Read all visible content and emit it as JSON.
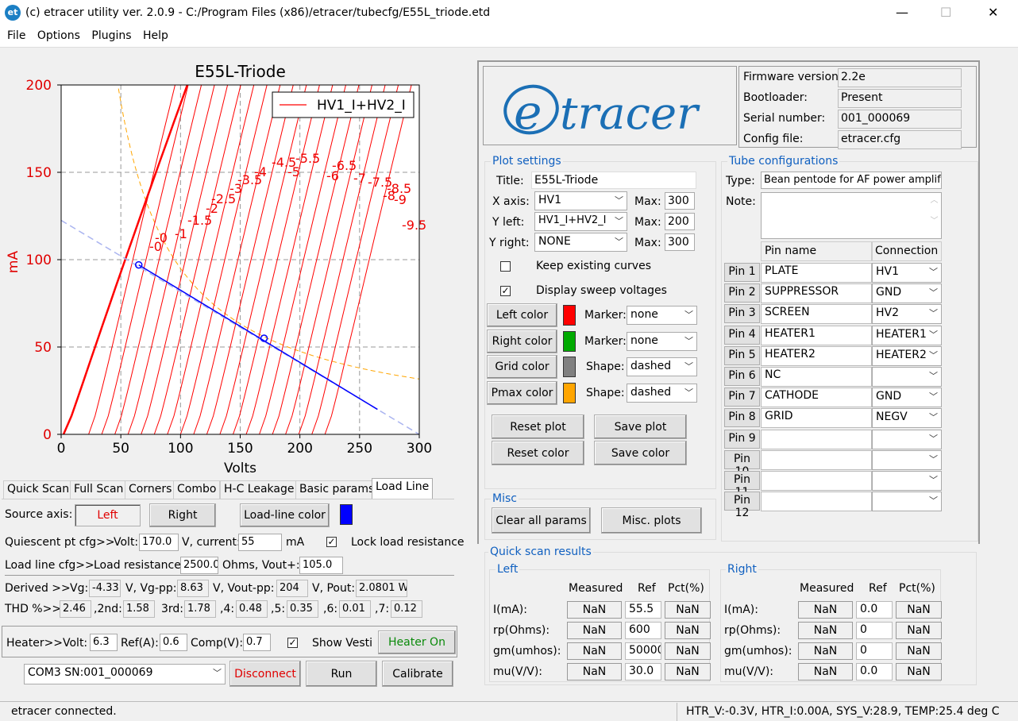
{
  "window": {
    "title": "(c) etracer utility ver. 2.0.9 - C:/Program Files (x86)/etracer/tubecfg/E55L_triode.etd",
    "icon_text": "et",
    "minimize": "—",
    "maximize": "☐",
    "close": "✕"
  },
  "menu": [
    "File",
    "Options",
    "Plugins",
    "Help"
  ],
  "chart_data": {
    "type": "line",
    "title": "E55L-Triode",
    "xlabel": "Volts",
    "ylabel": "mA",
    "xlim": [
      0,
      300
    ],
    "ylim": [
      0,
      200
    ],
    "xticks": [
      "0",
      "50",
      "100",
      "150",
      "200",
      "250",
      "300"
    ],
    "yticks": [
      "0",
      "50",
      "100",
      "150",
      "200"
    ],
    "legend": {
      "label": "HV1_I+HV2_I",
      "placement": "top-right"
    },
    "grid": true,
    "series_color": "#ff0000",
    "grid_voltages": [
      "-0",
      "-0",
      "-1",
      "-1.5",
      "-2",
      "-2.5",
      "-3",
      "-3.5",
      "-4",
      "-4.5",
      "-5",
      "-5.5",
      "-6",
      "-6.5",
      "-7",
      "-7.5",
      "-8",
      "-8.5",
      "-9",
      "-9.5"
    ],
    "load_line": {
      "x": [
        0,
        300
      ],
      "y": [
        122.5,
        0
      ]
    },
    "quiescent_points": [
      {
        "x": 65,
        "y": 97
      },
      {
        "x": 170,
        "y": 55
      }
    ]
  },
  "logo": "etracer",
  "firmware": {
    "rows": [
      {
        "label": "Firmware version:",
        "value": "2.2e"
      },
      {
        "label": "Bootloader:",
        "value": "Present"
      },
      {
        "label": "Serial number:",
        "value": "001_000069"
      },
      {
        "label": "Config file:",
        "value": "etracer.cfg"
      }
    ]
  },
  "plot_settings": {
    "group_title": "Plot settings",
    "title_label": "Title:",
    "title_value": "E55L-Triode",
    "x_axis_label": "X axis:",
    "x_axis_value": "HV1",
    "x_max_label": "Max:",
    "x_max": "300",
    "y_left_label": "Y left:",
    "y_left_value": "HV1_I+HV2_I",
    "y_left_max_label": "Max:",
    "y_left_max": "200",
    "y_right_label": "Y right:",
    "y_right_value": "NONE",
    "y_right_max_label": "Max:",
    "y_right_max": "300",
    "keep_curves": "Keep existing curves",
    "display_sweep": "Display sweep voltages",
    "left_color": "Left color",
    "right_color": "Right color",
    "grid_color": "Grid color",
    "pmax_color": "Pmax color",
    "marker_label": "Marker:",
    "shape_label": "Shape:",
    "left_marker": "none",
    "right_marker": "none",
    "grid_shape": "dashed",
    "pmax_shape": "dashed",
    "left_swatch": "#ff0000",
    "right_swatch": "#00aa00",
    "grid_swatch": "#808080",
    "pmax_swatch": "#ffa500",
    "reset_plot": "Reset plot",
    "save_plot": "Save plot",
    "reset_color": "Reset color",
    "save_color": "Save color"
  },
  "misc": {
    "group_title": "Misc",
    "clear_all": "Clear all params",
    "misc_plots": "Misc. plots"
  },
  "tube": {
    "group_title": "Tube configurations",
    "type_label": "Type:",
    "type_value": "Bean pentode for AF power amplif",
    "note_label": "Note:",
    "pin_name_header": "Pin name",
    "connection_header": "Connection",
    "pins": [
      {
        "btn": "Pin 1",
        "name": "PLATE",
        "conn": "HV1"
      },
      {
        "btn": "Pin 2",
        "name": "SUPPRESSOR",
        "conn": "GND"
      },
      {
        "btn": "Pin 3",
        "name": "SCREEN",
        "conn": "HV2"
      },
      {
        "btn": "Pin 4",
        "name": "HEATER1",
        "conn": "HEATER1"
      },
      {
        "btn": "Pin 5",
        "name": "HEATER2",
        "conn": "HEATER2"
      },
      {
        "btn": "Pin 6",
        "name": "NC",
        "conn": ""
      },
      {
        "btn": "Pin 7",
        "name": "CATHODE",
        "conn": "GND"
      },
      {
        "btn": "Pin 8",
        "name": "GRID",
        "conn": "NEGV"
      },
      {
        "btn": "Pin 9",
        "name": "",
        "conn": ""
      },
      {
        "btn": "Pin 10",
        "name": "",
        "conn": ""
      },
      {
        "btn": "Pin 11",
        "name": "",
        "conn": ""
      },
      {
        "btn": "Pin 12",
        "name": "",
        "conn": ""
      }
    ]
  },
  "quick_scan": {
    "group_title": "Quick scan results",
    "left_title": "Left",
    "right_title": "Right",
    "headers": [
      "Measured",
      "Ref",
      "Pct(%)"
    ],
    "row_labels": [
      "I(mA):",
      "rp(Ohms):",
      "gm(umhos):",
      "mu(V/V):"
    ],
    "left": [
      [
        "NaN",
        "55.5",
        "NaN"
      ],
      [
        "NaN",
        "600",
        "NaN"
      ],
      [
        "NaN",
        "50000",
        "NaN"
      ],
      [
        "NaN",
        "30.0",
        "NaN"
      ]
    ],
    "right": [
      [
        "NaN",
        "0.0",
        "NaN"
      ],
      [
        "NaN",
        "0",
        "NaN"
      ],
      [
        "NaN",
        "0",
        "NaN"
      ],
      [
        "NaN",
        "0.0",
        "NaN"
      ]
    ]
  },
  "tabs": [
    "Quick Scan",
    "Full Scan",
    "Corners",
    "Combo",
    "H-C Leakage",
    "Basic params",
    "Load Line"
  ],
  "loadline": {
    "source_axis": "Source axis:",
    "left": "Left",
    "right": "Right",
    "ll_color": "Load-line color",
    "ll_swatch": "#0000ff",
    "quiescent": "Quiescent pt cfg>>",
    "volt_label": "Volt:",
    "volt": "170.0",
    "v_current": "V, current:",
    "current": "55",
    "ma": "mA",
    "lock": "Lock load resistance",
    "ll_cfg": "Load line cfg>>",
    "load_res_label": "Load resistance:",
    "load_res": "2500.0",
    "ohms_vout": "Ohms, Vout+:",
    "vout": "105.0",
    "derived": "Derived >>",
    "vg_label": "Vg:",
    "vg": "-4.33",
    "vgpp_label": "V, Vg-pp:",
    "vgpp": "8.63",
    "voutpp_label": "V, Vout-pp:",
    "voutpp": "204",
    "pout_label": "V, Pout:",
    "pout": "2.0801 W",
    "thd": "THD %>>",
    "thd_val": "2.46",
    "h2_label": ",2nd:",
    "h2": "1.58",
    "h3_label": "3rd:",
    "h3": "1.78",
    "h4_label": ",4:",
    "h4": "0.48",
    "h5_label": ",5:",
    "h5": "0.35",
    "h6_label": ",6:",
    "h6": "0.01",
    "h7_label": ",7:",
    "h7": "0.12"
  },
  "heater": {
    "label": "Heater>>",
    "volt_label": "Volt:",
    "volt": "6.3",
    "ref_label": "Ref(A):",
    "ref": "0.6",
    "comp_label": "Comp(V):",
    "comp": "0.7",
    "show_vesti": "Show Vesti",
    "heater_on": "Heater On"
  },
  "bottom": {
    "port": "COM3 SN:001_000069",
    "disconnect": "Disconnect",
    "run": "Run",
    "calibrate": "Calibrate"
  },
  "status": {
    "left": "etracer connected.",
    "right": "HTR_V:-0.3V, HTR_I:0.00A, SYS_V:28.9, TEMP:25.4 deg C"
  }
}
